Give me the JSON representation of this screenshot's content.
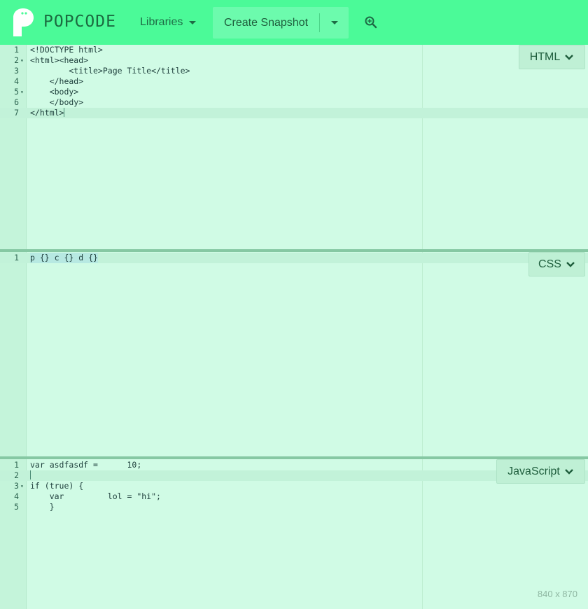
{
  "topbar": {
    "brand": "POPCODE",
    "libraries_label": "Libraries",
    "snapshot_label": "Create Snapshot"
  },
  "editors": [
    {
      "language": "HTML",
      "lines": [
        {
          "num": "1",
          "text": "<!DOCTYPE html>"
        },
        {
          "num": "2",
          "text": "<html><head>",
          "fold": true
        },
        {
          "num": "3",
          "text": "        <title>Page Title</title>"
        },
        {
          "num": "4",
          "text": "    </head>"
        },
        {
          "num": "5",
          "text": "    <body>",
          "fold": true
        },
        {
          "num": "6",
          "text": "    </body>"
        },
        {
          "num": "7",
          "text": "</html>"
        }
      ]
    },
    {
      "language": "CSS",
      "lines": [
        {
          "num": "1",
          "text": "p {} c {} d {}"
        }
      ]
    },
    {
      "language": "JavaScript",
      "lines": [
        {
          "num": "1",
          "text": "var asdfasdf =      10;"
        },
        {
          "num": "2",
          "text": ""
        },
        {
          "num": "3",
          "text": "if (true) {",
          "fold": true
        },
        {
          "num": "4",
          "text": "    var         lol = \"hi\";"
        },
        {
          "num": "5",
          "text": "    }"
        }
      ]
    }
  ],
  "viewport_size": "840 x 870"
}
